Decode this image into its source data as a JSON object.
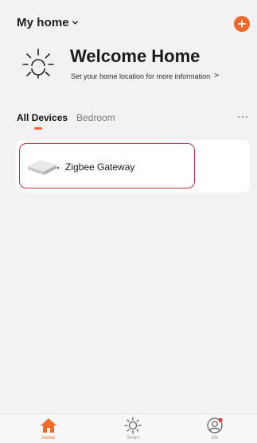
{
  "header": {
    "home_name": "My home",
    "chevron_icon": "chevron-down-icon",
    "add_icon": "plus-icon",
    "accent_color": "#f06a2b"
  },
  "welcome": {
    "icon": "sun-icon",
    "title": "Welcome Home",
    "subtitle": "Set your home location for more information",
    "arrow": ">"
  },
  "tabs": {
    "items": [
      {
        "label": "All Devices",
        "active": true
      },
      {
        "label": "Bedroom",
        "active": false
      }
    ],
    "more_icon": "more-dots-icon"
  },
  "devices": [
    {
      "name": "Zigbee Gateway",
      "icon": "gateway-icon",
      "highlight_color": "#c5323b"
    }
  ],
  "bottom_nav": {
    "items": [
      {
        "label": "Home",
        "icon": "home-icon",
        "active": true
      },
      {
        "label": "Smart",
        "icon": "smart-sun-icon",
        "active": false
      },
      {
        "label": "Me",
        "icon": "user-icon",
        "active": false
      }
    ]
  }
}
